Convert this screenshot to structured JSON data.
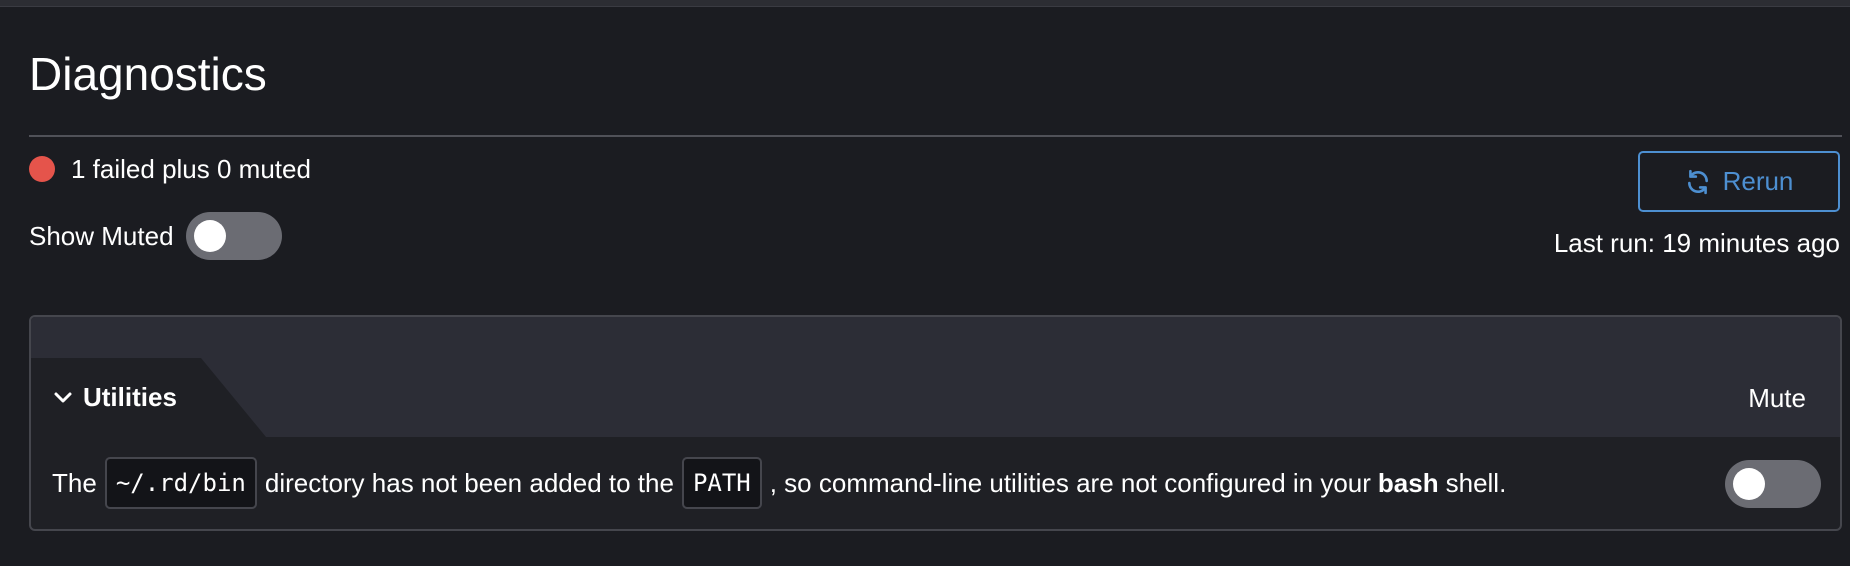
{
  "page": {
    "title": "Diagnostics"
  },
  "status": {
    "summary": "1 failed plus 0 muted",
    "indicator_color": "#e5544b"
  },
  "show_muted": {
    "label": "Show Muted",
    "enabled": false
  },
  "rerun": {
    "label": "Rerun",
    "icon": "refresh-icon",
    "accent_color": "#4d8fd1"
  },
  "last_run": {
    "text": "Last run: 19 minutes ago"
  },
  "panel": {
    "group_label": "Utilities",
    "group_expanded": true,
    "mute_column_label": "Mute",
    "items": [
      {
        "text_before": "The",
        "code_1": "~/.rd/bin",
        "text_middle": "directory has not been added to the",
        "code_2": "PATH",
        "text_after": ", so command-line utilities are not configured in your",
        "shell": "bash",
        "text_end": "shell.",
        "muted": false
      }
    ]
  }
}
